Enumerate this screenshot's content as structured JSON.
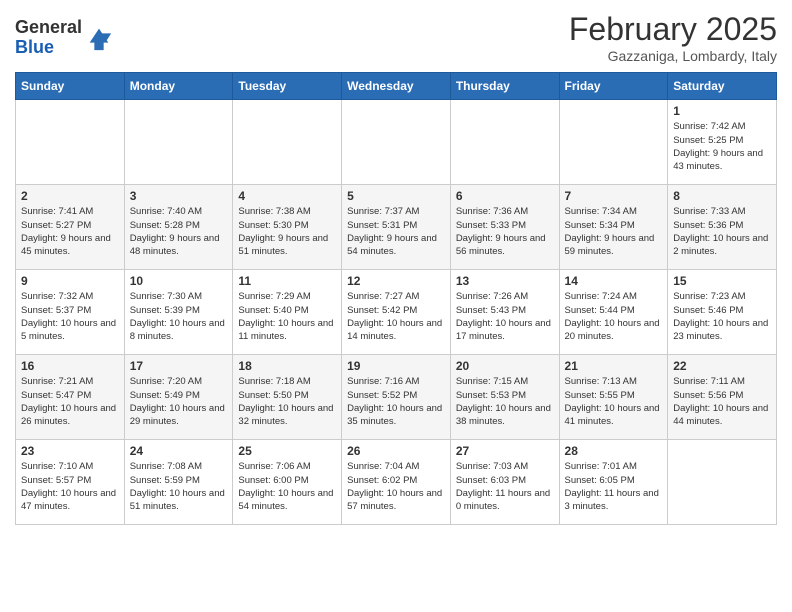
{
  "logo": {
    "general": "General",
    "blue": "Blue"
  },
  "title": "February 2025",
  "subtitle": "Gazzaniga, Lombardy, Italy",
  "days_of_week": [
    "Sunday",
    "Monday",
    "Tuesday",
    "Wednesday",
    "Thursday",
    "Friday",
    "Saturday"
  ],
  "weeks": [
    [
      {
        "day": "",
        "info": ""
      },
      {
        "day": "",
        "info": ""
      },
      {
        "day": "",
        "info": ""
      },
      {
        "day": "",
        "info": ""
      },
      {
        "day": "",
        "info": ""
      },
      {
        "day": "",
        "info": ""
      },
      {
        "day": "1",
        "info": "Sunrise: 7:42 AM\nSunset: 5:25 PM\nDaylight: 9 hours and 43 minutes."
      }
    ],
    [
      {
        "day": "2",
        "info": "Sunrise: 7:41 AM\nSunset: 5:27 PM\nDaylight: 9 hours and 45 minutes."
      },
      {
        "day": "3",
        "info": "Sunrise: 7:40 AM\nSunset: 5:28 PM\nDaylight: 9 hours and 48 minutes."
      },
      {
        "day": "4",
        "info": "Sunrise: 7:38 AM\nSunset: 5:30 PM\nDaylight: 9 hours and 51 minutes."
      },
      {
        "day": "5",
        "info": "Sunrise: 7:37 AM\nSunset: 5:31 PM\nDaylight: 9 hours and 54 minutes."
      },
      {
        "day": "6",
        "info": "Sunrise: 7:36 AM\nSunset: 5:33 PM\nDaylight: 9 hours and 56 minutes."
      },
      {
        "day": "7",
        "info": "Sunrise: 7:34 AM\nSunset: 5:34 PM\nDaylight: 9 hours and 59 minutes."
      },
      {
        "day": "8",
        "info": "Sunrise: 7:33 AM\nSunset: 5:36 PM\nDaylight: 10 hours and 2 minutes."
      }
    ],
    [
      {
        "day": "9",
        "info": "Sunrise: 7:32 AM\nSunset: 5:37 PM\nDaylight: 10 hours and 5 minutes."
      },
      {
        "day": "10",
        "info": "Sunrise: 7:30 AM\nSunset: 5:39 PM\nDaylight: 10 hours and 8 minutes."
      },
      {
        "day": "11",
        "info": "Sunrise: 7:29 AM\nSunset: 5:40 PM\nDaylight: 10 hours and 11 minutes."
      },
      {
        "day": "12",
        "info": "Sunrise: 7:27 AM\nSunset: 5:42 PM\nDaylight: 10 hours and 14 minutes."
      },
      {
        "day": "13",
        "info": "Sunrise: 7:26 AM\nSunset: 5:43 PM\nDaylight: 10 hours and 17 minutes."
      },
      {
        "day": "14",
        "info": "Sunrise: 7:24 AM\nSunset: 5:44 PM\nDaylight: 10 hours and 20 minutes."
      },
      {
        "day": "15",
        "info": "Sunrise: 7:23 AM\nSunset: 5:46 PM\nDaylight: 10 hours and 23 minutes."
      }
    ],
    [
      {
        "day": "16",
        "info": "Sunrise: 7:21 AM\nSunset: 5:47 PM\nDaylight: 10 hours and 26 minutes."
      },
      {
        "day": "17",
        "info": "Sunrise: 7:20 AM\nSunset: 5:49 PM\nDaylight: 10 hours and 29 minutes."
      },
      {
        "day": "18",
        "info": "Sunrise: 7:18 AM\nSunset: 5:50 PM\nDaylight: 10 hours and 32 minutes."
      },
      {
        "day": "19",
        "info": "Sunrise: 7:16 AM\nSunset: 5:52 PM\nDaylight: 10 hours and 35 minutes."
      },
      {
        "day": "20",
        "info": "Sunrise: 7:15 AM\nSunset: 5:53 PM\nDaylight: 10 hours and 38 minutes."
      },
      {
        "day": "21",
        "info": "Sunrise: 7:13 AM\nSunset: 5:55 PM\nDaylight: 10 hours and 41 minutes."
      },
      {
        "day": "22",
        "info": "Sunrise: 7:11 AM\nSunset: 5:56 PM\nDaylight: 10 hours and 44 minutes."
      }
    ],
    [
      {
        "day": "23",
        "info": "Sunrise: 7:10 AM\nSunset: 5:57 PM\nDaylight: 10 hours and 47 minutes."
      },
      {
        "day": "24",
        "info": "Sunrise: 7:08 AM\nSunset: 5:59 PM\nDaylight: 10 hours and 51 minutes."
      },
      {
        "day": "25",
        "info": "Sunrise: 7:06 AM\nSunset: 6:00 PM\nDaylight: 10 hours and 54 minutes."
      },
      {
        "day": "26",
        "info": "Sunrise: 7:04 AM\nSunset: 6:02 PM\nDaylight: 10 hours and 57 minutes."
      },
      {
        "day": "27",
        "info": "Sunrise: 7:03 AM\nSunset: 6:03 PM\nDaylight: 11 hours and 0 minutes."
      },
      {
        "day": "28",
        "info": "Sunrise: 7:01 AM\nSunset: 6:05 PM\nDaylight: 11 hours and 3 minutes."
      },
      {
        "day": "",
        "info": ""
      }
    ]
  ]
}
